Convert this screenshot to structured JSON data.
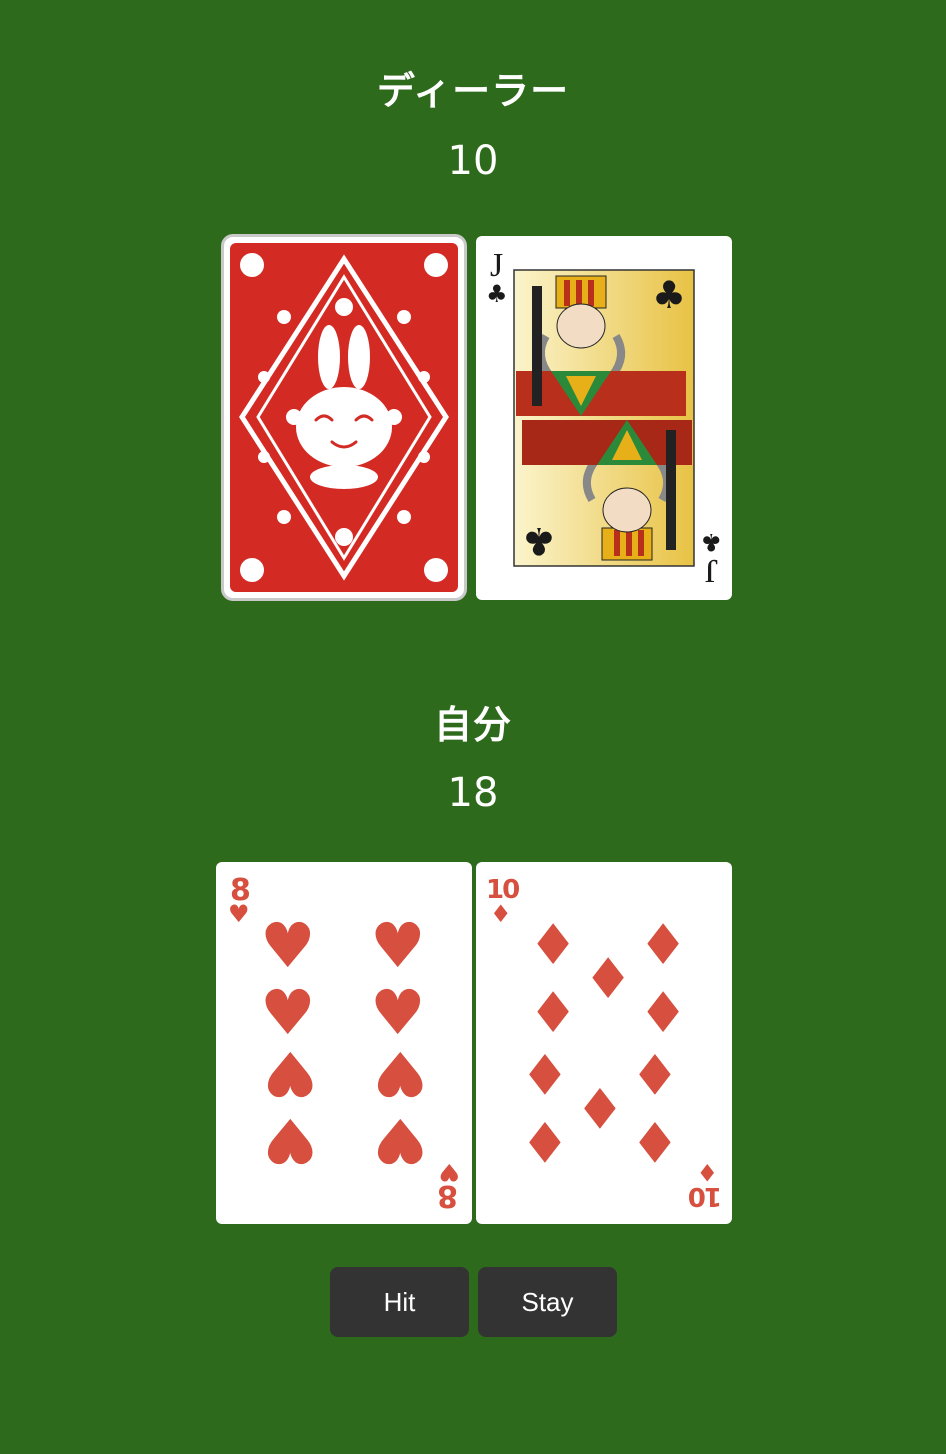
{
  "dealer": {
    "label": "ディーラー",
    "score": "10",
    "cards": [
      {
        "face": "back"
      },
      {
        "rank": "J",
        "suit": "club",
        "color": "#1a1a1a"
      }
    ]
  },
  "player": {
    "label": "自分",
    "score": "18",
    "cards": [
      {
        "rank": "8",
        "suit": "heart",
        "color": "#d64f3f"
      },
      {
        "rank": "10",
        "suit": "diamond",
        "color": "#d64f3f"
      }
    ]
  },
  "controls": {
    "hit_label": "Hit",
    "stay_label": "Stay"
  },
  "colors": {
    "table": "#2d6a1b",
    "card_back": "#d32a24",
    "button": "#333333",
    "red_suit": "#d64f3f"
  }
}
